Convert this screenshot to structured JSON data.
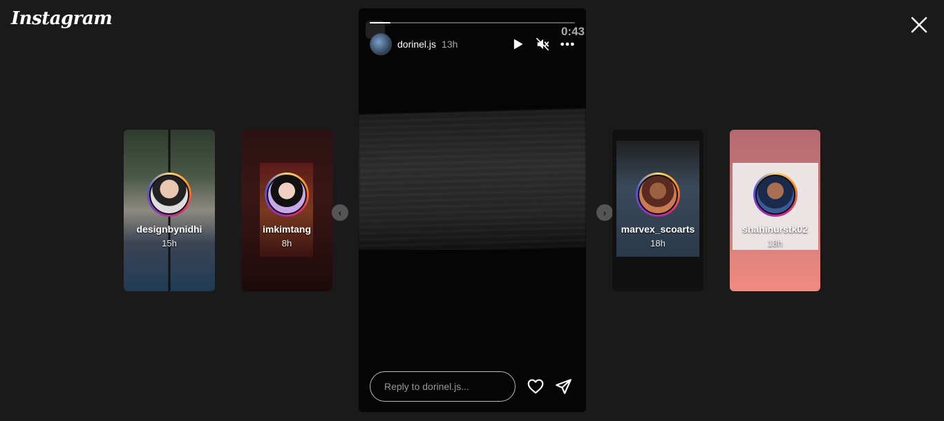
{
  "app": {
    "logo_text": "Instagram"
  },
  "thumbnails": [
    {
      "username": "designbynidhi",
      "time": "15h"
    },
    {
      "username": "imkimtang",
      "time": "8h"
    },
    {
      "username": "marvex_scoarts",
      "time": "18h"
    },
    {
      "username": "shahinurstk02",
      "time": "18h"
    }
  ],
  "story": {
    "username": "dorinel.js",
    "time": "13h",
    "timecode": "0:43",
    "progress": 0.1,
    "reply_placeholder": "Reply to dorinel.js..."
  },
  "icons": {
    "close": "close-icon",
    "play": "play-icon",
    "mute": "volume-muted-icon",
    "more": "more-horizontal-icon",
    "like": "heart-icon",
    "share": "send-icon",
    "prev": "chevron-left-icon",
    "next": "chevron-right-icon"
  },
  "colors": {
    "background": "#1a1a1a",
    "story_bg": "#050505"
  }
}
